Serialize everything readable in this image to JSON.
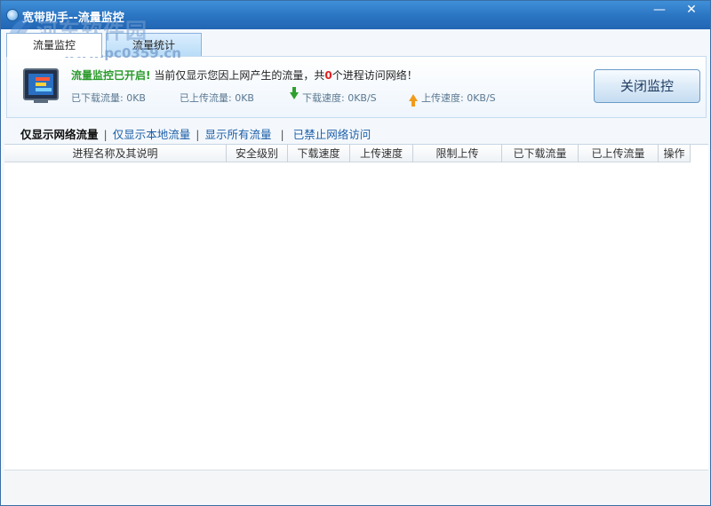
{
  "window": {
    "title": "宽带助手--流量监控",
    "minimize_glyph": "—",
    "close_glyph": "✕"
  },
  "watermark": {
    "text": "河东软件园",
    "url": "www.pc0359.cn"
  },
  "tabs": [
    {
      "label": "流量监控",
      "active": true
    },
    {
      "label": "流量统计",
      "active": false
    }
  ],
  "status": {
    "enabled_text": "流量监控已开启!",
    "prefix": "当前仅显示您因上网产生的流量，共",
    "process_count": "0",
    "suffix": "个进程访问网络！"
  },
  "stats": {
    "downloaded": "已下载流量: 0KB",
    "uploaded": "已上传流量: 0KB",
    "download_speed": "下载速度: 0KB/S",
    "upload_speed": "上传速度: 0KB/S"
  },
  "actions": {
    "close_monitor": "关闭监控"
  },
  "filters": {
    "items": [
      "仅显示网络流量",
      "仅显示本地流量",
      "显示所有流量",
      "已禁止网络访问"
    ],
    "separator": "|",
    "active_index": 0
  },
  "table": {
    "columns": [
      "进程名称及其说明",
      "安全级别",
      "下载速度",
      "上传速度",
      "限制上传",
      "已下载流量",
      "已上传流量",
      "操作"
    ],
    "rows": []
  },
  "colors": {
    "titlebar": "#2a74c2",
    "status_on": "#2a9a2a",
    "count": "#e02020",
    "link": "#1d5fa8",
    "download_arrow": "#2da02d",
    "upload_arrow": "#f19b1d"
  }
}
